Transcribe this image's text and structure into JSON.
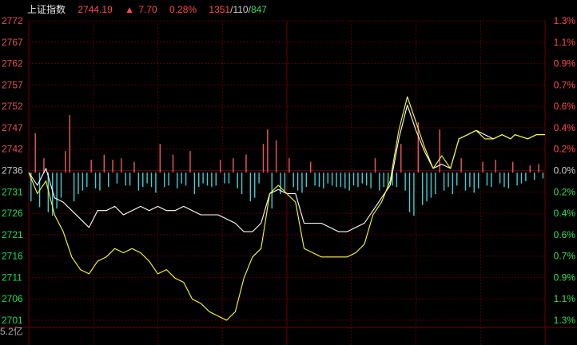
{
  "header": {
    "index_name": "上证指数",
    "price": "2744.19",
    "change_arrow": "▲",
    "change": "7.70",
    "change_pct": "0.28%",
    "breadth_up": "1351",
    "breadth_sep1": "/",
    "breadth_flat": "110",
    "breadth_sep2": "/",
    "breadth_down": "847"
  },
  "volume_label": "5.2亿",
  "colors": {
    "up": "#ff4444",
    "down": "#22dd55",
    "neutral": "#cccccc",
    "grid": "#5a0000",
    "index_line": "#ffffff",
    "avg_line": "#ffff33",
    "up_bar": "#f25757",
    "down_bar": "#3fcfd6",
    "label_left": "#e25252",
    "label_right_up": "#ff4a4a",
    "label_right_down": "#33e055"
  },
  "chart_data": {
    "type": "line",
    "base_value": 2736,
    "ylim": [
      2701,
      2772
    ],
    "y_ticks_left": [
      "2772",
      "2767",
      "2762",
      "2757",
      "2752",
      "2747",
      "2742",
      "2736",
      "2731",
      "2726",
      "2721",
      "2716",
      "2711",
      "2706",
      "2701"
    ],
    "y_ticks_right": [
      "1.3%",
      "1.1%",
      "0.9%",
      "0.7%",
      "0.6%",
      "0.4%",
      "0.2%",
      "0.0%",
      "0.2%",
      "0.4%",
      "0.6%",
      "0.7%",
      "0.9%",
      "1.1%",
      "1.3%"
    ],
    "series": [
      {
        "x": [
          0,
          4,
          8,
          12,
          16,
          20,
          24,
          28,
          32,
          36,
          40,
          44,
          48,
          52,
          56,
          60,
          64,
          68,
          72,
          76,
          80,
          84,
          88,
          92,
          96,
          100,
          104,
          108,
          112,
          116,
          120,
          124,
          128,
          132,
          136,
          140,
          144,
          148,
          152,
          156,
          160,
          164,
          168,
          172,
          176,
          180,
          184,
          188,
          192,
          196,
          200,
          204,
          208,
          212,
          216,
          220,
          224,
          226,
          232,
          236,
          240
        ],
        "values": [
          2736,
          2733,
          2737,
          2730,
          2729,
          2727,
          2725,
          2723,
          2727,
          2727,
          2728,
          2726,
          2727,
          2728,
          2727,
          2728,
          2727,
          2727,
          2728,
          2727,
          2726,
          2726,
          2726,
          2725,
          2724,
          2722,
          2722,
          2724,
          2731,
          2732,
          2731,
          2731,
          2724,
          2724,
          2724,
          2723,
          2722,
          2722,
          2723,
          2724,
          2727,
          2730,
          2733,
          2744,
          2752,
          2746,
          2741,
          2737,
          2738,
          2737,
          2744,
          2745,
          2746,
          2745,
          2744,
          2745,
          2744,
          2745,
          2744,
          2745,
          2745
        ]
      },
      {
        "x": [
          0,
          4,
          8,
          12,
          16,
          20,
          24,
          28,
          32,
          36,
          40,
          44,
          48,
          52,
          56,
          60,
          64,
          68,
          72,
          76,
          80,
          84,
          88,
          92,
          96,
          100,
          104,
          108,
          112,
          116,
          120,
          124,
          128,
          132,
          136,
          140,
          144,
          148,
          152,
          156,
          160,
          164,
          168,
          172,
          176,
          180,
          184,
          188,
          192,
          196,
          200,
          204,
          208,
          212,
          216,
          220,
          224,
          226,
          232,
          236,
          240
        ],
        "values": [
          2736,
          2731,
          2734,
          2726,
          2722,
          2716,
          2713,
          2712,
          2715,
          2716,
          2718,
          2717,
          2718,
          2717,
          2715,
          2712,
          2713,
          2711,
          2710,
          2706,
          2705,
          2703,
          2702,
          2701,
          2703,
          2711,
          2716,
          2718,
          2731,
          2733,
          2731,
          2729,
          2718,
          2717,
          2716,
          2716,
          2716,
          2716,
          2717,
          2719,
          2726,
          2729,
          2734,
          2746,
          2754,
          2748,
          2742,
          2737,
          2740,
          2737,
          2744,
          2745,
          2746,
          2744,
          2744,
          2745,
          2744,
          2745,
          2744,
          2745,
          2745
        ]
      }
    ],
    "volume": {
      "x": [
        1,
        3,
        5,
        7,
        9,
        11,
        13,
        15,
        17,
        19,
        21,
        23,
        25,
        27,
        29,
        31,
        33,
        35,
        37,
        39,
        41,
        43,
        45,
        47,
        49,
        51,
        53,
        55,
        57,
        59,
        61,
        63,
        65,
        67,
        69,
        71,
        73,
        75,
        77,
        79,
        81,
        83,
        85,
        87,
        89,
        91,
        93,
        95,
        97,
        99,
        101,
        103,
        105,
        107,
        109,
        111,
        113,
        115,
        117,
        119,
        121,
        123,
        125,
        127,
        129,
        131,
        133,
        135,
        137,
        139,
        141,
        143,
        145,
        147,
        149,
        151,
        153,
        155,
        157,
        159,
        161,
        163,
        165,
        167,
        169,
        171,
        173,
        175,
        177,
        179,
        181,
        183,
        185,
        187,
        189,
        191,
        193,
        195,
        197,
        199,
        201,
        203,
        205,
        207,
        209,
        211,
        213,
        215,
        217,
        219,
        221,
        223,
        225,
        227,
        229,
        231,
        233,
        235,
        237,
        239
      ],
      "values": [
        -40,
        55,
        -48,
        20,
        -55,
        -60,
        -50,
        -35,
        30,
        80,
        -40,
        -30,
        -25,
        -20,
        18,
        -22,
        -25,
        25,
        -20,
        18,
        -15,
        20,
        -18,
        -18,
        15,
        -25,
        -20,
        -15,
        -20,
        -28,
        40,
        -20,
        -18,
        25,
        -22,
        -15,
        -18,
        30,
        -30,
        -20,
        -15,
        -18,
        -20,
        -18,
        18,
        -15,
        -15,
        20,
        -22,
        -30,
        25,
        -40,
        -35,
        -15,
        40,
        60,
        -50,
        45,
        -30,
        -25,
        20,
        -20,
        -25,
        -28,
        -20,
        15,
        -18,
        -20,
        -22,
        -15,
        -18,
        -20,
        -20,
        -22,
        -25,
        -18,
        -20,
        -15,
        -18,
        -22,
        20,
        -25,
        -20,
        -22,
        -18,
        -20,
        40,
        -25,
        -55,
        -60,
        70,
        -45,
        -40,
        -35,
        -30,
        60,
        -25,
        -20,
        -30,
        -18,
        20,
        -25,
        -20,
        -28,
        -22,
        15,
        -18,
        -20,
        18,
        -15,
        -20,
        -22,
        15,
        -18,
        -15,
        -12,
        10,
        -10,
        12,
        -8,
        10,
        -8
      ]
    },
    "xlabel": "",
    "ylabel": ""
  }
}
